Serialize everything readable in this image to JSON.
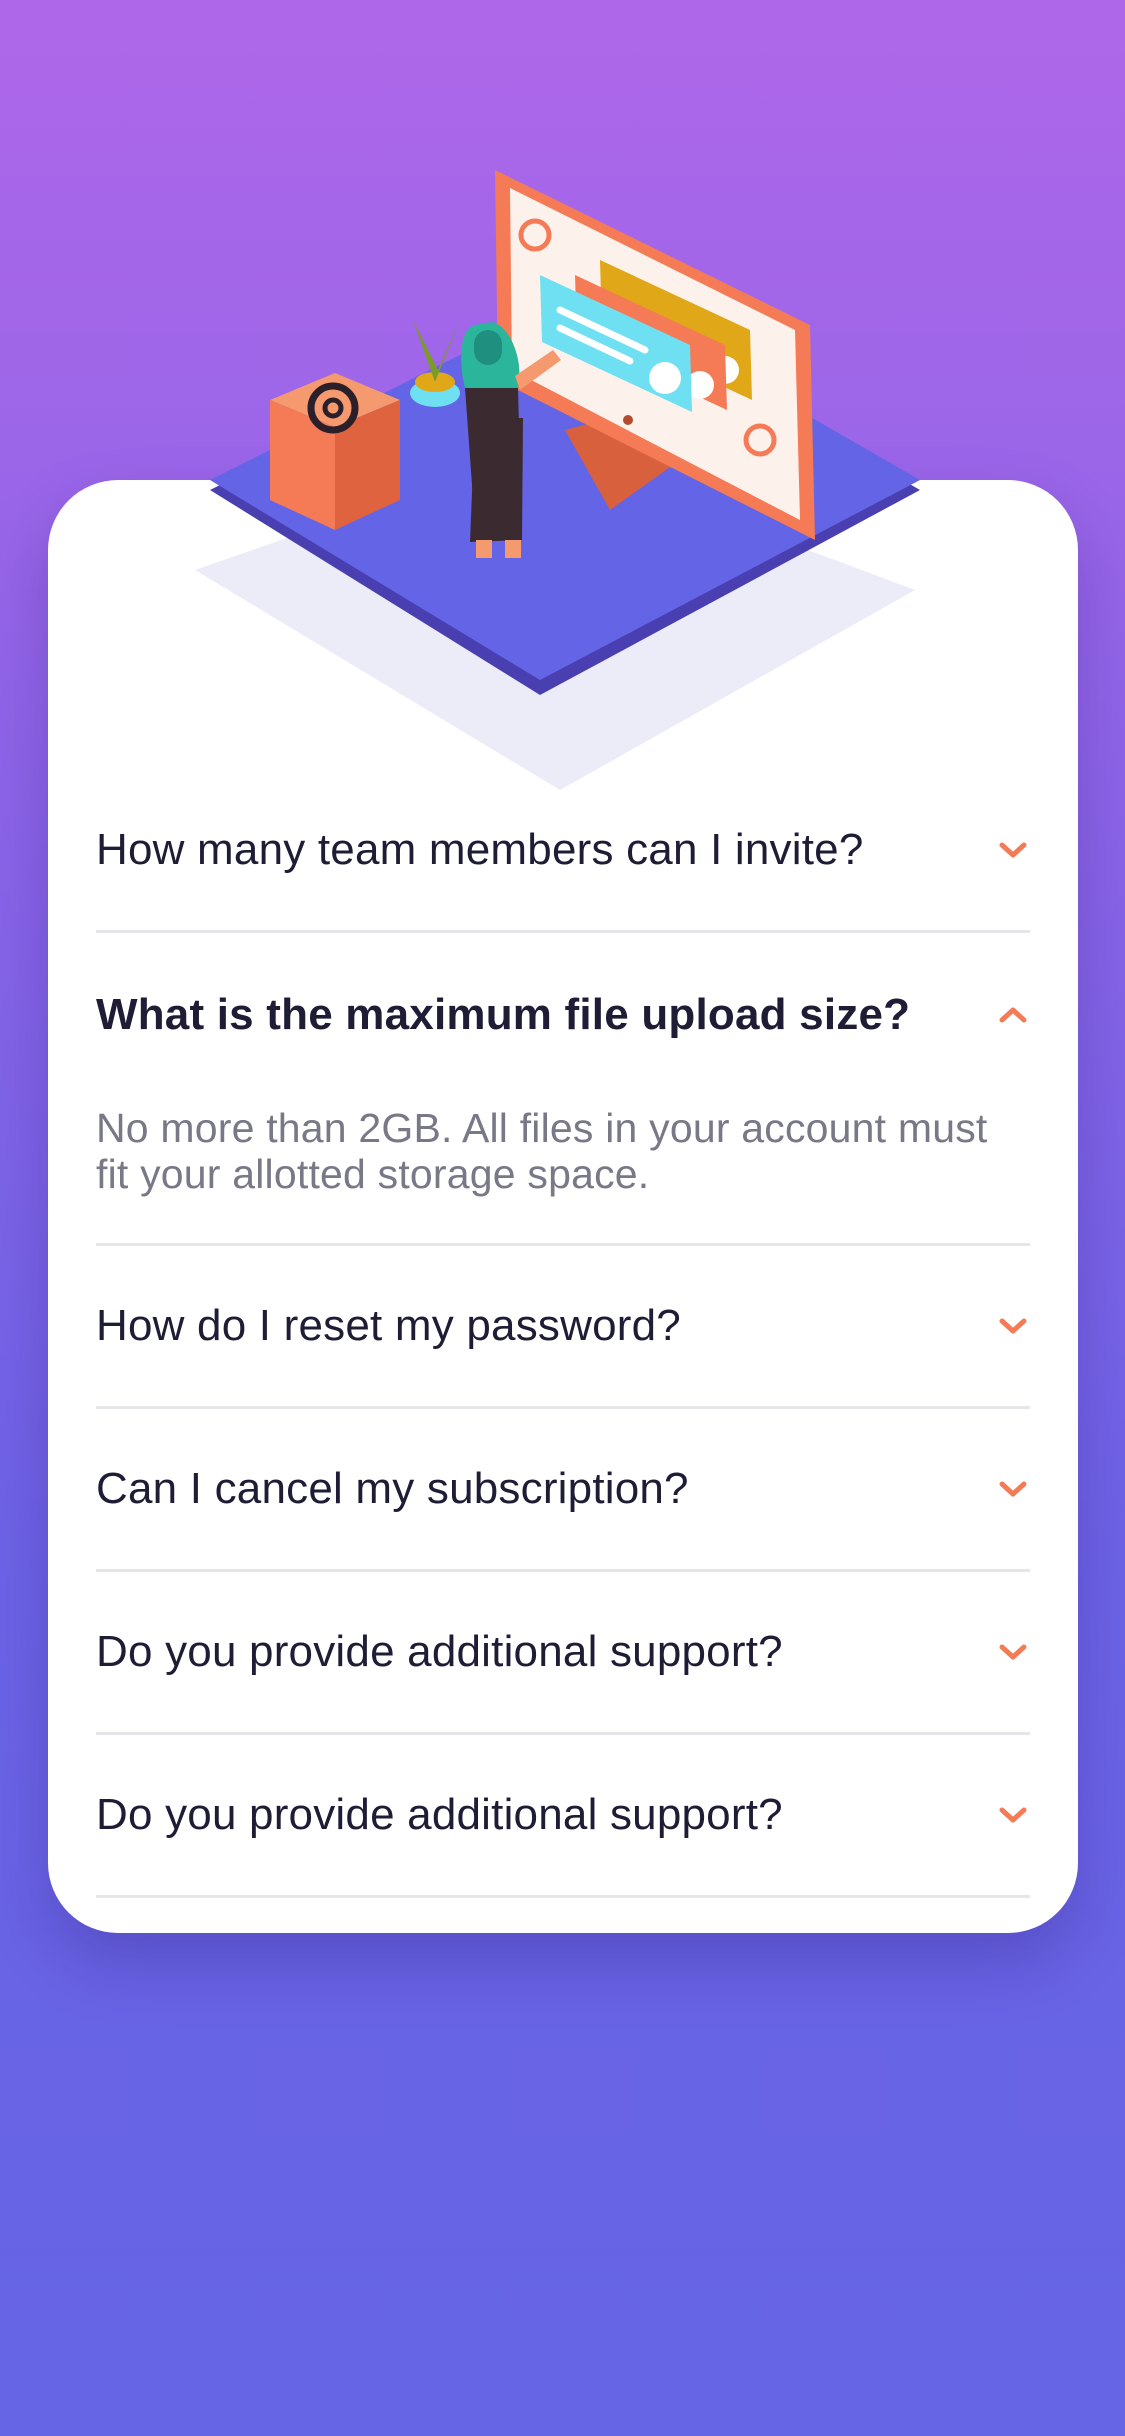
{
  "colors": {
    "accent": "#f47b56",
    "text_dark": "#1f1d36",
    "text_muted": "#787887",
    "divider": "#e6e6ea"
  },
  "icons": {
    "collapsed": "chevron-down-icon",
    "expanded": "chevron-up-icon"
  },
  "faq": {
    "items": [
      {
        "question": "How many team members can I invite?",
        "expanded": false
      },
      {
        "question": "What is the maximum file upload size?",
        "expanded": true,
        "answer": "No more than 2GB. All files in your account must fit your allotted storage space."
      },
      {
        "question": "How do I reset my password?",
        "expanded": false
      },
      {
        "question": "Can I cancel my subscription?",
        "expanded": false
      },
      {
        "question": "Do you provide additional support?",
        "expanded": false
      },
      {
        "question": "Do you provide additional support?",
        "expanded": false
      }
    ]
  }
}
